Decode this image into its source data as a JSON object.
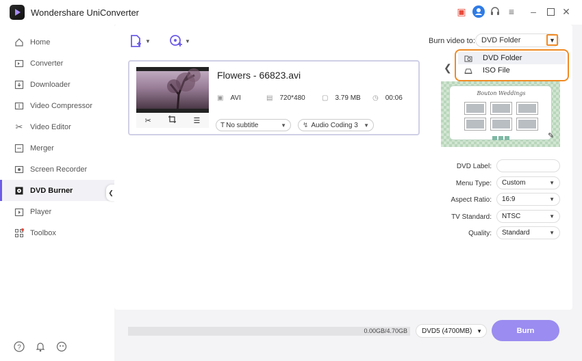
{
  "app": {
    "title": "Wondershare UniConverter"
  },
  "sidebar": {
    "items": [
      {
        "label": "Home",
        "icon": "home-icon"
      },
      {
        "label": "Converter",
        "icon": "converter-icon"
      },
      {
        "label": "Downloader",
        "icon": "downloader-icon"
      },
      {
        "label": "Video Compressor",
        "icon": "compress-icon"
      },
      {
        "label": "Video Editor",
        "icon": "scissors-icon"
      },
      {
        "label": "Merger",
        "icon": "merge-icon"
      },
      {
        "label": "Screen Recorder",
        "icon": "record-icon"
      },
      {
        "label": "DVD Burner",
        "icon": "disc-icon",
        "active": true
      },
      {
        "label": "Player",
        "icon": "play-icon"
      },
      {
        "label": "Toolbox",
        "icon": "grid-icon"
      }
    ]
  },
  "burn_to": {
    "label": "Burn video to:",
    "value": "DVD Folder",
    "options": [
      "DVD Folder",
      "ISO File"
    ]
  },
  "file": {
    "name": "Flowers - 66823.avi",
    "format": "AVI",
    "resolution": "720*480",
    "size": "3.79 MB",
    "duration": "00:06",
    "subtitle": "No subtitle",
    "audio": "Audio Coding 3"
  },
  "template": {
    "title": "Bouton Weddings"
  },
  "settings": {
    "dvd_label": {
      "label": "DVD Label:",
      "value": ""
    },
    "menu_type": {
      "label": "Menu Type:",
      "value": "Custom"
    },
    "aspect_ratio": {
      "label": "Aspect Ratio:",
      "value": "16:9"
    },
    "tv_standard": {
      "label": "TV Standard:",
      "value": "NTSC"
    },
    "quality": {
      "label": "Quality:",
      "value": "Standard"
    }
  },
  "footer": {
    "usage": "0.00GB/4.70GB",
    "usage_fraction": 0.0,
    "disc": "DVD5 (4700MB)",
    "burn_label": "Burn"
  },
  "colors": {
    "accent": "#6c5ce7",
    "highlight": "#f08a24",
    "burn_button": "#9a8cf0"
  }
}
